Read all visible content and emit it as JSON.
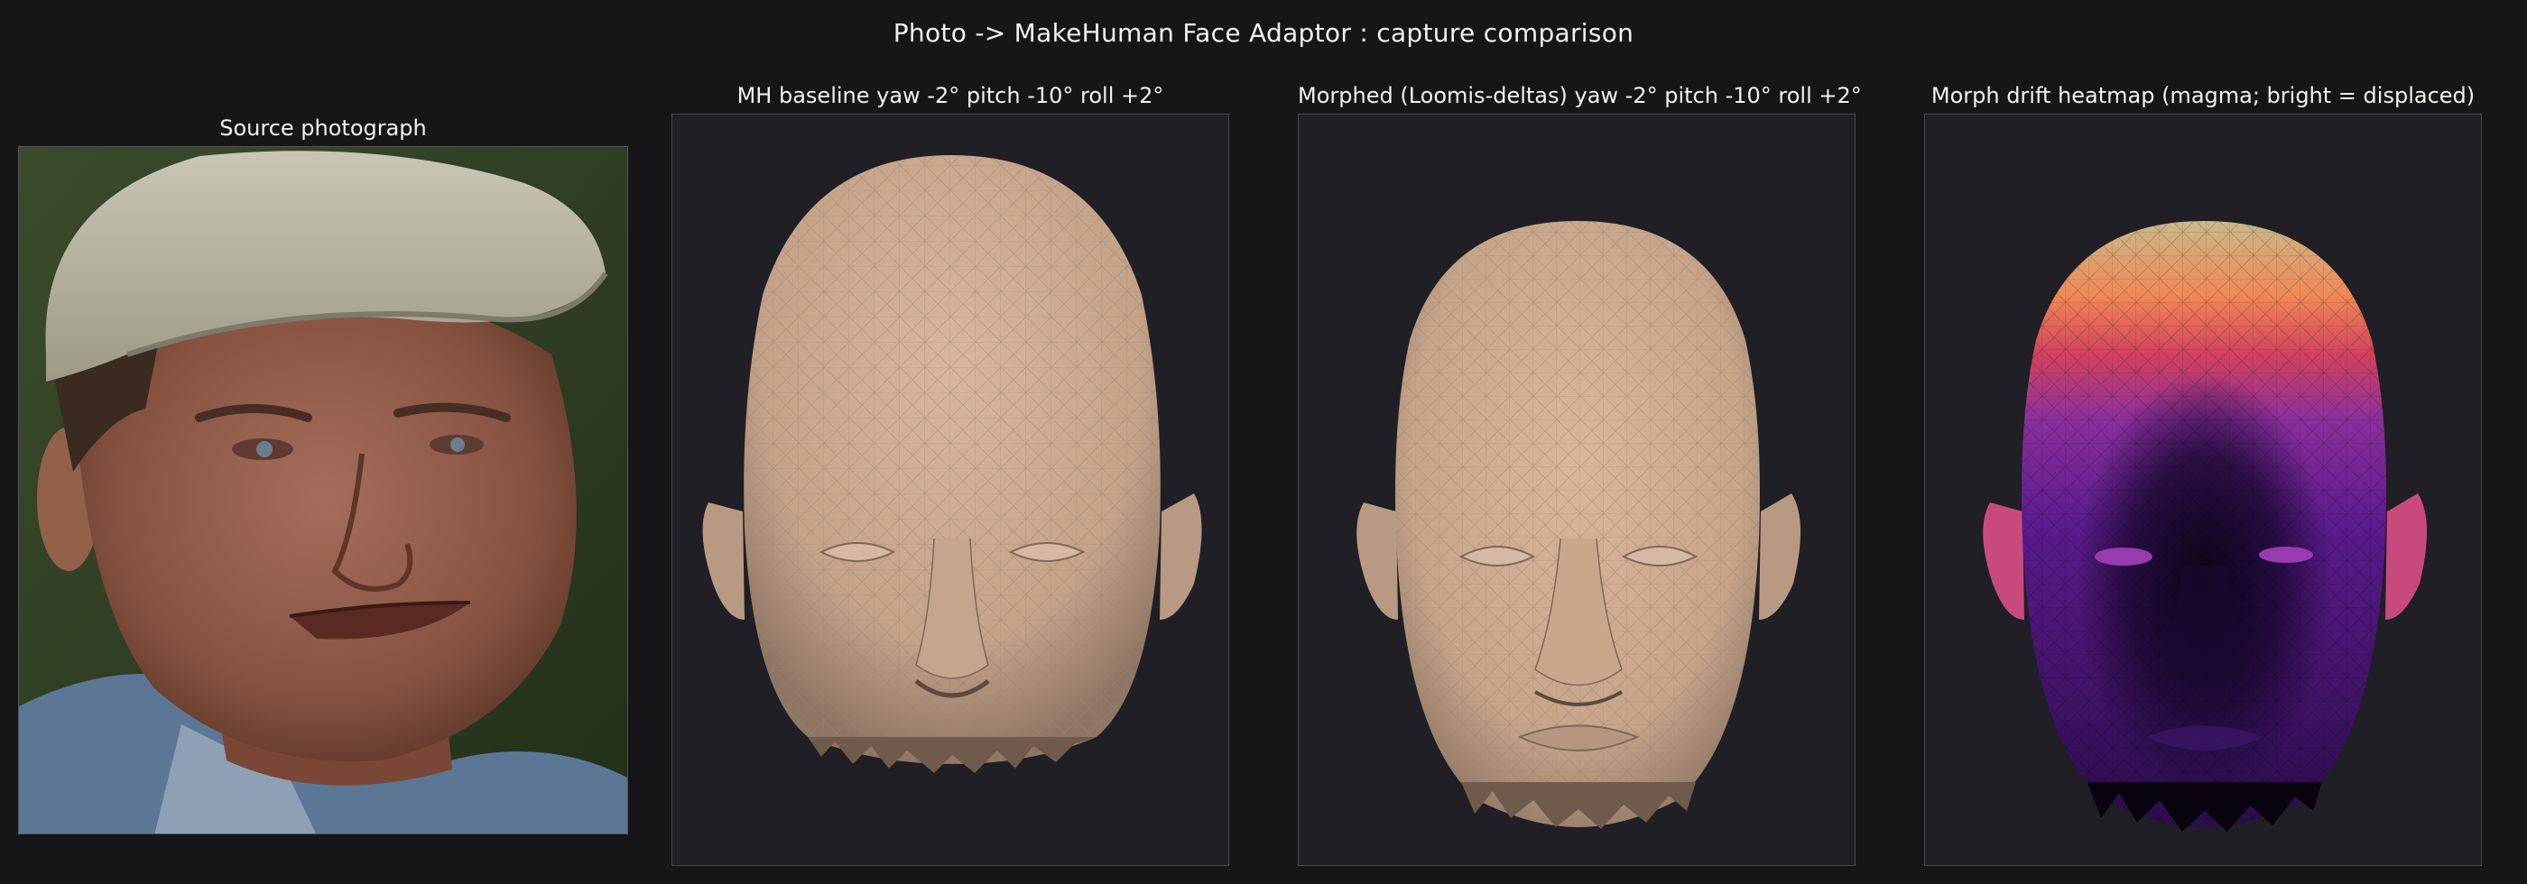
{
  "window": {
    "title": "Photo -> MakeHuman Face Adaptor : capture comparison"
  },
  "panels": [
    {
      "title": "Source photograph"
    },
    {
      "title": "MH baseline  yaw -2°  pitch -10°  roll +2°"
    },
    {
      "title": "Morphed (Loomis-deltas)  yaw -2°  pitch -10°  roll +2°"
    },
    {
      "title": "Morph drift heatmap  (magma; bright = displaced)"
    }
  ],
  "colors": {
    "background": "#15151a",
    "panel_bg": "#1f1f25",
    "skin": "#c8a88e",
    "magma_bright": "#c9b98a",
    "magma_mid": "#d2425e",
    "magma_low": "#5b1b8c",
    "magma_dark": "#0a0414"
  }
}
